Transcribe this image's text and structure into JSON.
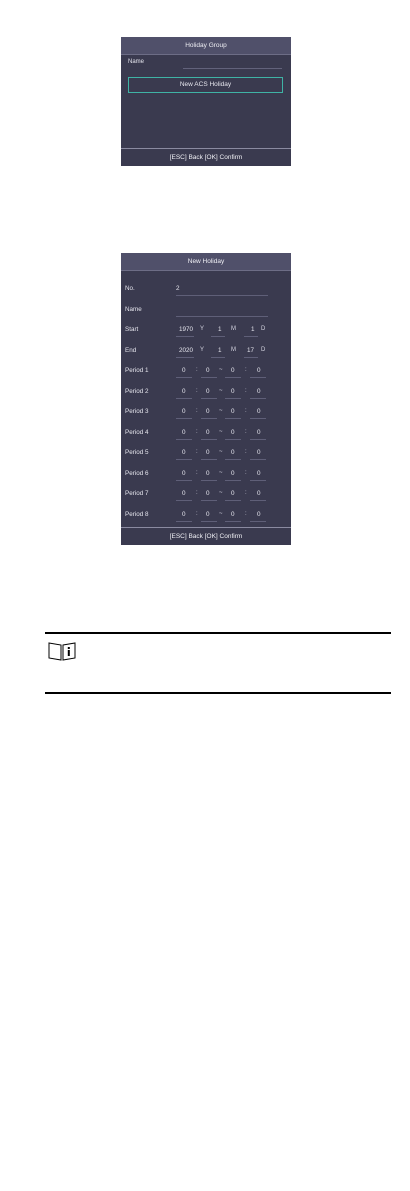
{
  "holiday_group": {
    "title": "Holiday Group",
    "name_label": "Name",
    "item": "New ACS Holiday",
    "footer": "[ESC] Back [OK] Confirm"
  },
  "new_holiday": {
    "title": "New Holiday",
    "no_label": "No.",
    "no_value": "2",
    "name_label": "Name",
    "start_label": "Start",
    "start": {
      "year": "1970",
      "y": "Y",
      "month": "1",
      "m": "M",
      "day": "1",
      "d": "D"
    },
    "end_label": "End",
    "end": {
      "year": "2020",
      "y": "Y",
      "month": "1",
      "m": "M",
      "day": "17",
      "d": "D"
    },
    "periods": [
      {
        "label": "Period 1",
        "h1": "0",
        "m1": "0",
        "h2": "0",
        "m2": "0"
      },
      {
        "label": "Period 2",
        "h1": "0",
        "m1": "0",
        "h2": "0",
        "m2": "0"
      },
      {
        "label": "Period 3",
        "h1": "0",
        "m1": "0",
        "h2": "0",
        "m2": "0"
      },
      {
        "label": "Period 4",
        "h1": "0",
        "m1": "0",
        "h2": "0",
        "m2": "0"
      },
      {
        "label": "Period 5",
        "h1": "0",
        "m1": "0",
        "h2": "0",
        "m2": "0"
      },
      {
        "label": "Period 6",
        "h1": "0",
        "m1": "0",
        "h2": "0",
        "m2": "0"
      },
      {
        "label": "Period 7",
        "h1": "0",
        "m1": "0",
        "h2": "0",
        "m2": "0"
      },
      {
        "label": "Period 8",
        "h1": "0",
        "m1": "0",
        "h2": "0",
        "m2": "0"
      }
    ],
    "time_colon": ":",
    "range_dash": "~",
    "footer": "[ESC] Back [OK] Confirm"
  },
  "note": {
    "icon": "info-book-icon"
  }
}
